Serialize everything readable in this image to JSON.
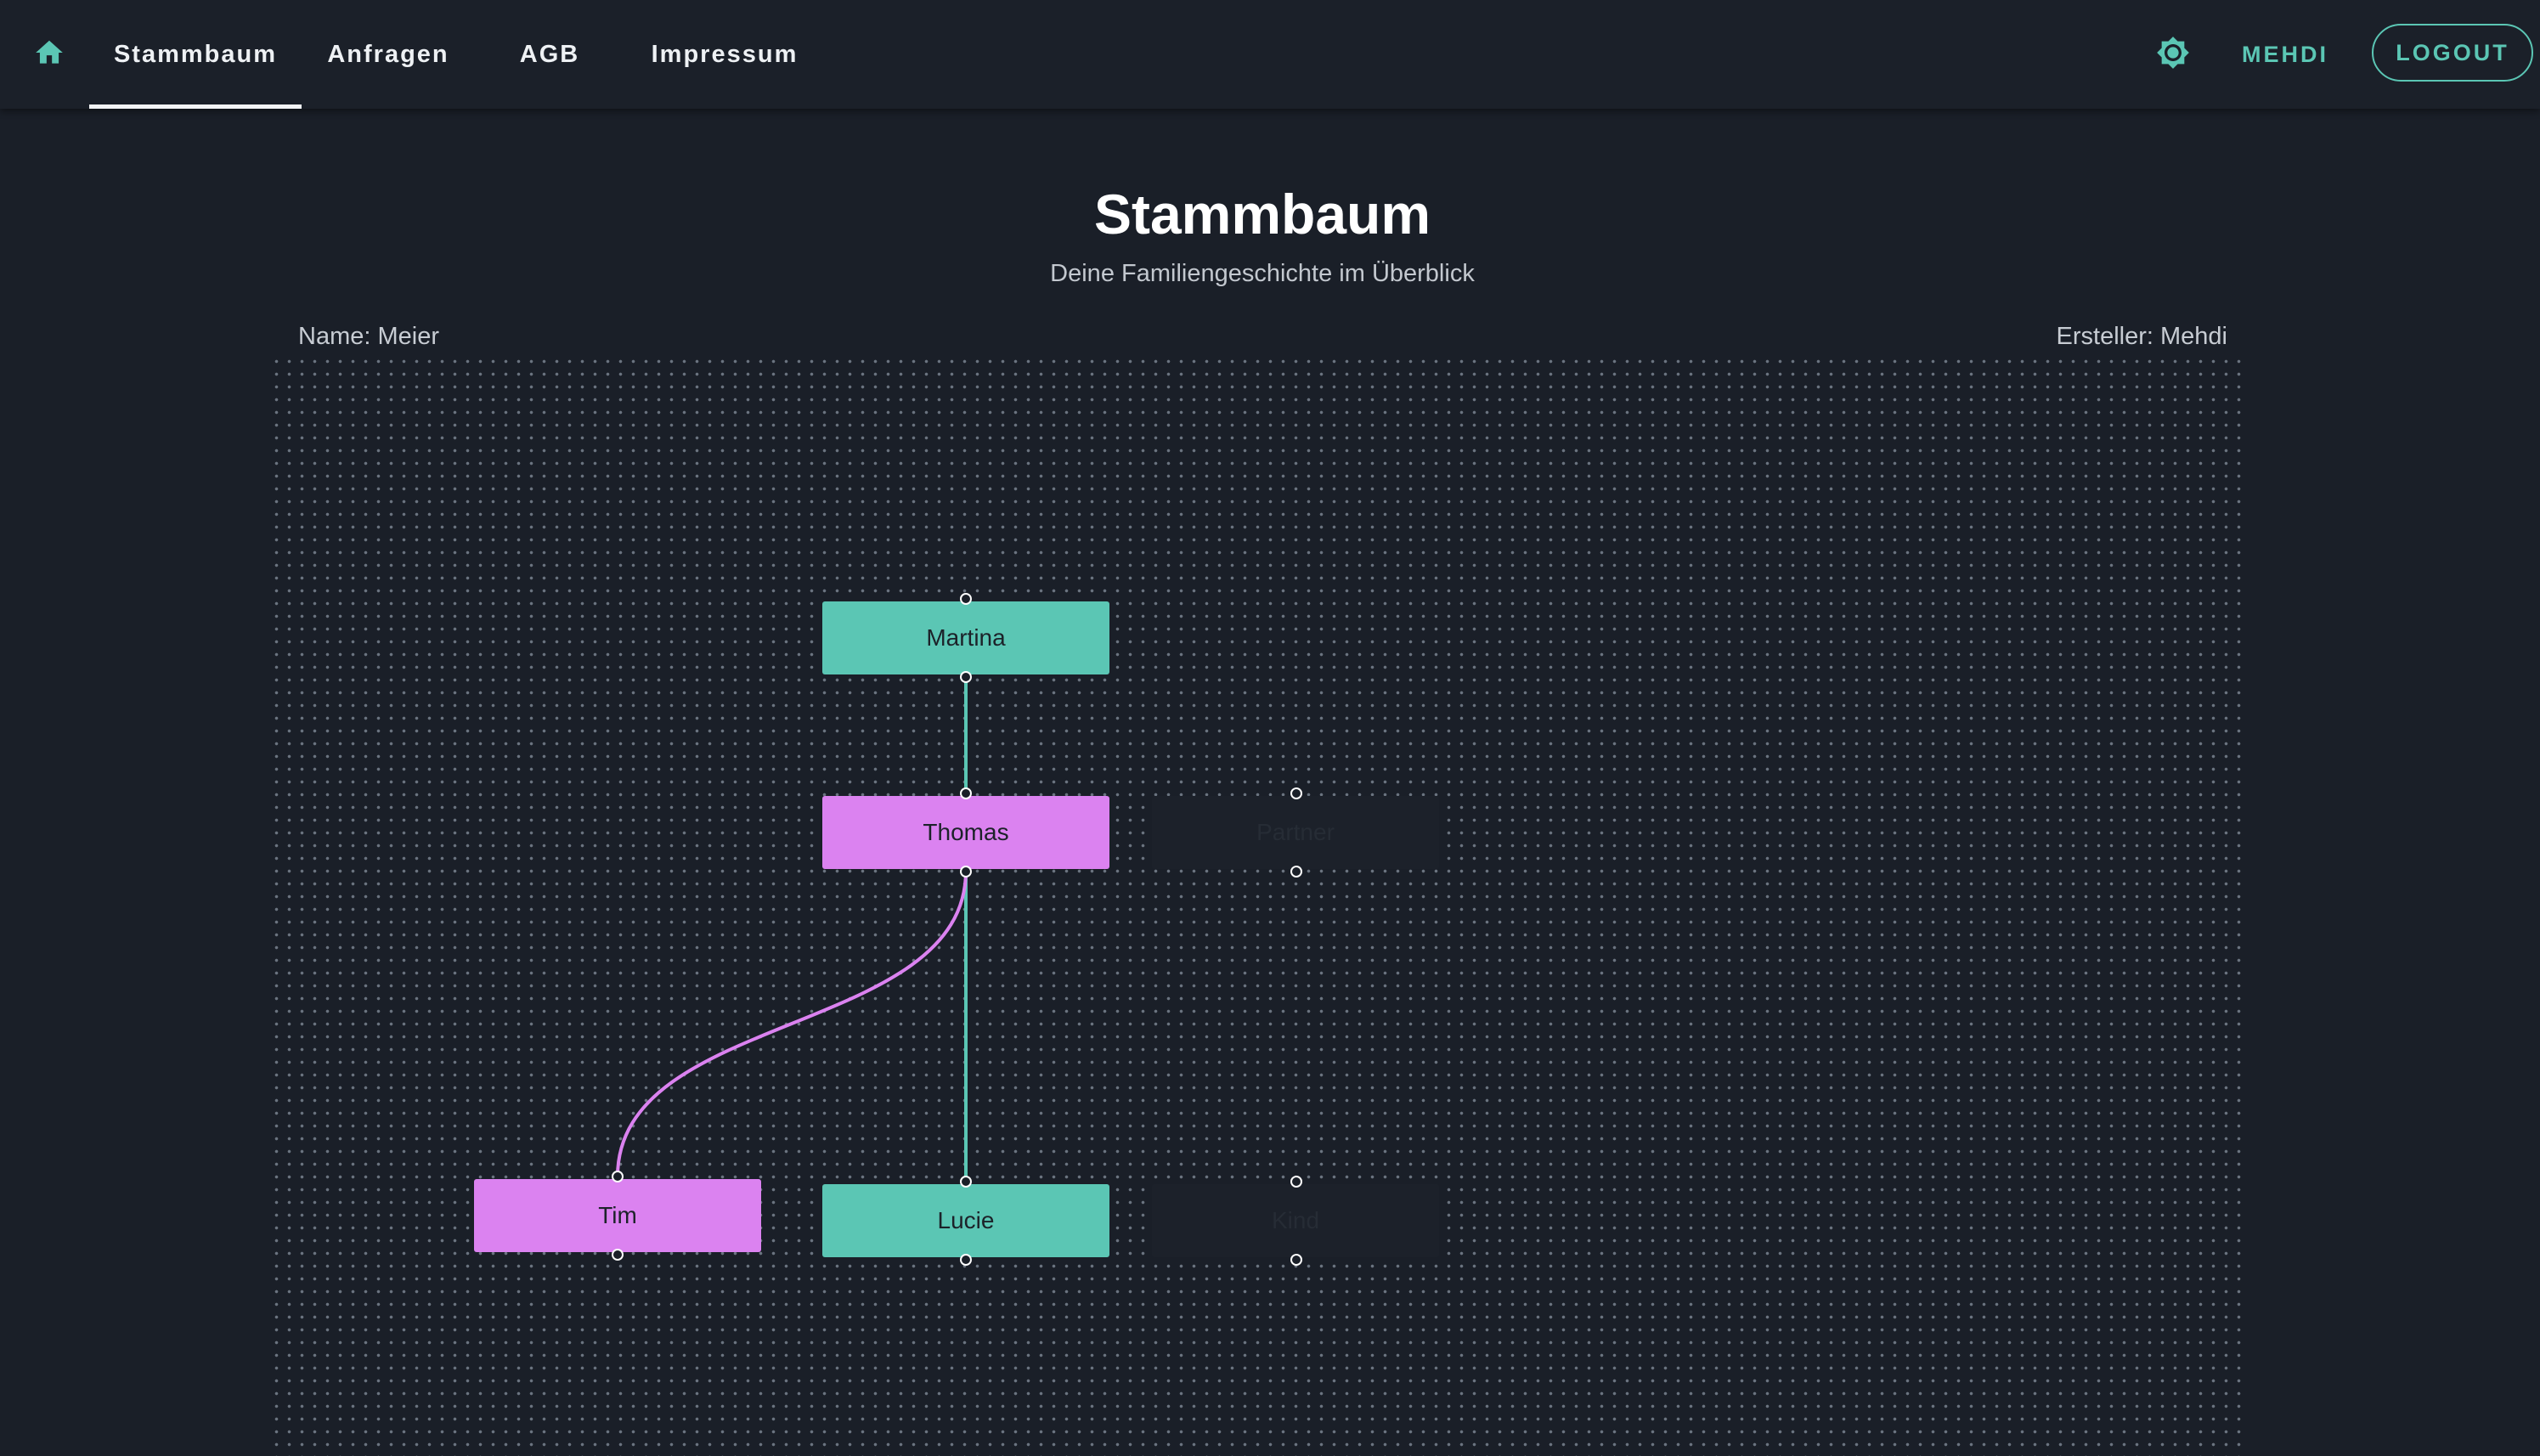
{
  "nav": {
    "tabs": [
      {
        "label": "Stammbaum",
        "active": true
      },
      {
        "label": "Anfragen",
        "active": false
      },
      {
        "label": "AGB",
        "active": false
      },
      {
        "label": "Impressum",
        "active": false
      }
    ],
    "home_icon": "home-icon",
    "theme_icon": "brightness-icon",
    "user_label": "MEHDI",
    "logout_label": "LOGOUT"
  },
  "header": {
    "title": "Stammbaum",
    "subtitle": "Deine Familiengeschichte im Überblick"
  },
  "tree_meta": {
    "name": "Name: Meier",
    "creator": "Ersteller: Mehdi"
  },
  "tree": {
    "nodes": [
      {
        "id": "martina",
        "label": "Martina",
        "color": "#5bc6b4"
      },
      {
        "id": "thomas",
        "label": "Thomas",
        "color": "#db82f0"
      },
      {
        "id": "partner1",
        "label": "Partner",
        "color": "#1c212a"
      },
      {
        "id": "tim",
        "label": "Tim",
        "color": "#db82f0"
      },
      {
        "id": "lucie",
        "label": "Lucie",
        "color": "#5bc6b4"
      },
      {
        "id": "partner2",
        "label": "Kind",
        "color": "#1c212a"
      }
    ],
    "edges": [
      {
        "from": "martina",
        "to": "thomas",
        "color": "#5bc6b4"
      },
      {
        "from": "thomas",
        "to": "lucie",
        "color": "#5bc6b4"
      },
      {
        "from": "thomas",
        "to": "tim",
        "color": "#db82f0"
      }
    ]
  },
  "colors": {
    "background": "#1a1f28",
    "accent": "#5bc6b4",
    "pink": "#db82f0"
  }
}
